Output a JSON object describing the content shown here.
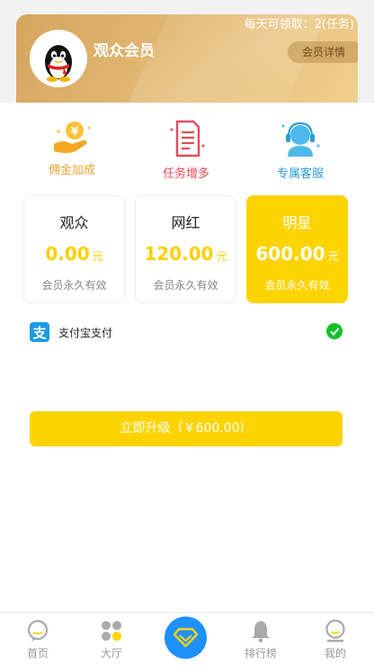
{
  "header": {
    "member_title": "观众会员",
    "daily_quota": "每天可领取：2(任务)",
    "details_button": "会员详情",
    "avatar_icon": "qq-penguin-avatar"
  },
  "benefits": [
    {
      "label": "佣金加成",
      "icon": "hand-coin-icon",
      "color": "#f0a43a"
    },
    {
      "label": "任务增多",
      "icon": "document-list-icon",
      "color": "#e34b5a"
    },
    {
      "label": "专属客服",
      "icon": "customer-service-icon",
      "color": "#2b9ed8"
    }
  ],
  "plans": [
    {
      "name": "观众",
      "price": "0.00",
      "unit": "元",
      "validity": "会员永久有效",
      "selected": false
    },
    {
      "name": "网红",
      "price": "120.00",
      "unit": "元",
      "validity": "会员永久有效",
      "selected": false
    },
    {
      "name": "明星",
      "price": "600.00",
      "unit": "元",
      "validity": "会员永久有效",
      "selected": true
    }
  ],
  "payment": {
    "method_label": "支付宝支付",
    "icon": "alipay-icon",
    "checked": true
  },
  "upgrade_button": "立即升级（￥600.00）",
  "tabbar": [
    {
      "label": "首页",
      "icon": "home-chat-icon"
    },
    {
      "label": "大厅",
      "icon": "hall-dots-icon"
    },
    {
      "label": "",
      "icon": "diamond-icon"
    },
    {
      "label": "排行榜",
      "icon": "bell-icon"
    },
    {
      "label": "我的",
      "icon": "profile-icon"
    }
  ],
  "colors": {
    "accent": "#fdd400",
    "tab_center": "#1e90ff",
    "check_green": "#14c02a",
    "alipay_blue": "#1b9be6"
  }
}
